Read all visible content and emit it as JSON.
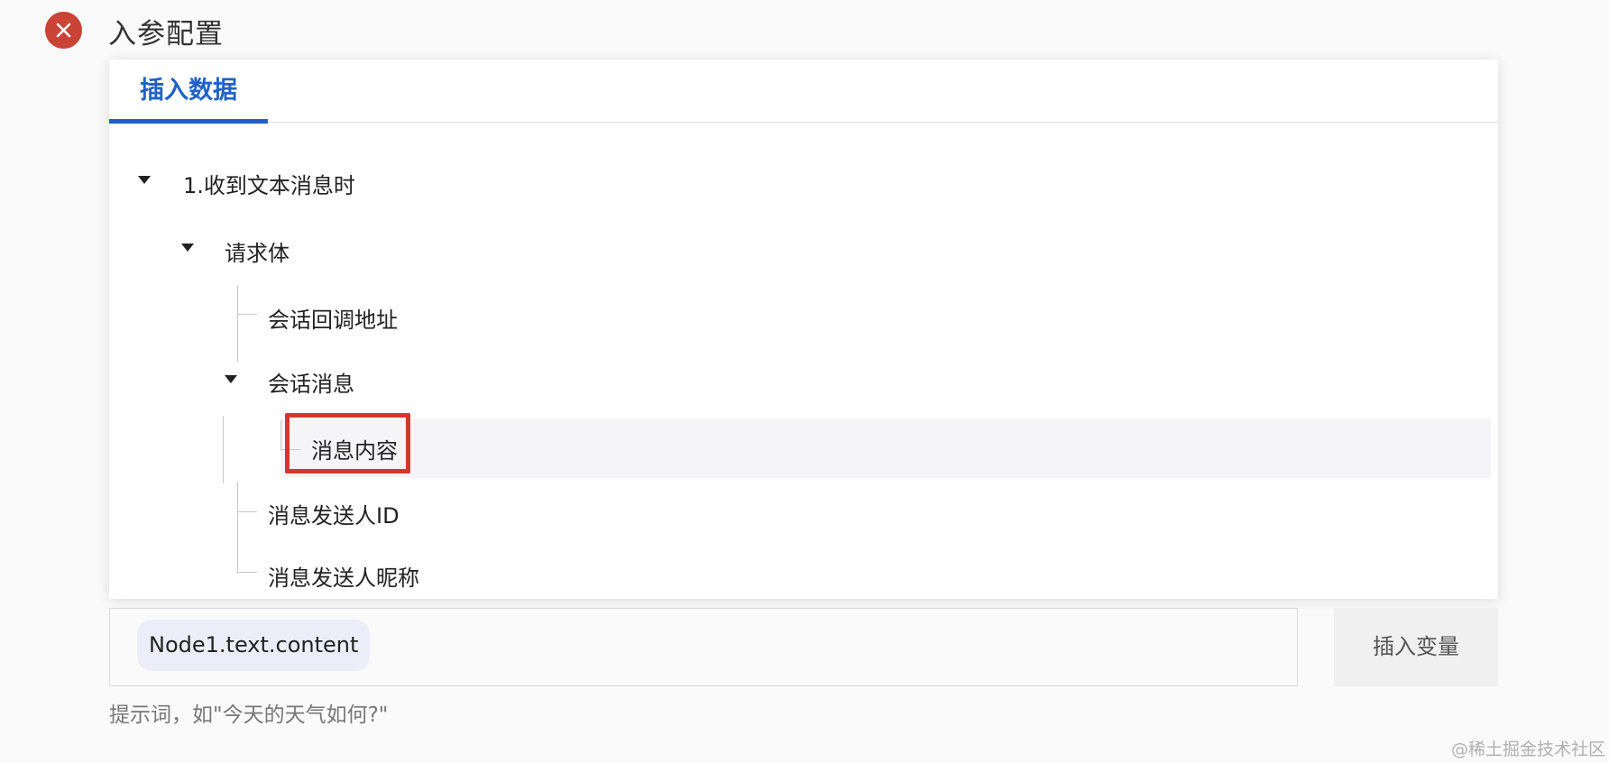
{
  "header": {
    "title": "入参配置",
    "close_icon": "close-icon",
    "close_color": "#c94336"
  },
  "panel": {
    "tabs": [
      {
        "label": "插入数据",
        "active": true
      }
    ],
    "tree": {
      "root": {
        "label": "1.收到文本消息时",
        "expanded": true
      },
      "request_body": {
        "label": "请求体",
        "expanded": true
      },
      "callback_url": {
        "label": "会话回调地址"
      },
      "session_message": {
        "label": "会话消息",
        "expanded": true
      },
      "message_content": {
        "label": "消息内容",
        "highlighted": true
      },
      "sender_id": {
        "label": "消息发送人ID"
      },
      "sender_nickname": {
        "label": "消息发送人昵称"
      }
    }
  },
  "input": {
    "variable_chip": "Node1.text.content",
    "insert_button": "插入变量",
    "hint": "提示词，如\"今天的天气如何?\""
  },
  "watermark": "@稀土掘金技术社区",
  "colors": {
    "accent": "#1f62c7",
    "highlight_box": "#d1392e",
    "chip_bg": "#ededf9"
  }
}
